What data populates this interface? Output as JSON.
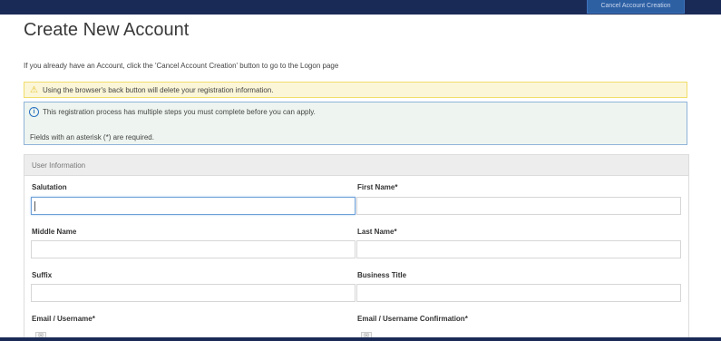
{
  "header": {
    "cancel_button_label": "Cancel Account Creation"
  },
  "page": {
    "title": "Create New Account",
    "intro": "If you already have an Account, click the 'Cancel Account Creation' button to go to the Logon page"
  },
  "alerts": {
    "warning": "Using the browser's back button will delete your registration information.",
    "info_line1": "This registration process has multiple steps you must complete before you can apply.",
    "info_line2": "Fields with an asterisk (*) are required."
  },
  "panel": {
    "title": "User Information"
  },
  "fields": {
    "salutation": {
      "label": "Salutation",
      "value": ""
    },
    "first_name": {
      "label": "First Name*",
      "value": ""
    },
    "middle_name": {
      "label": "Middle Name",
      "value": ""
    },
    "last_name": {
      "label": "Last Name*",
      "value": ""
    },
    "suffix": {
      "label": "Suffix",
      "value": ""
    },
    "business_title": {
      "label": "Business Title",
      "value": ""
    },
    "email": {
      "label": "Email / Username*",
      "value": ""
    },
    "email_confirm": {
      "label": "Email / Username Confirmation*",
      "value": ""
    }
  },
  "colors": {
    "navbar": "#1a2a57",
    "warning_bg": "#fbf6d8",
    "info_bg": "#eef5f0",
    "info_border": "#8fb3d9"
  },
  "icons": {
    "warning": "warning-icon",
    "info": "info-icon",
    "email": "envelope-icon"
  }
}
